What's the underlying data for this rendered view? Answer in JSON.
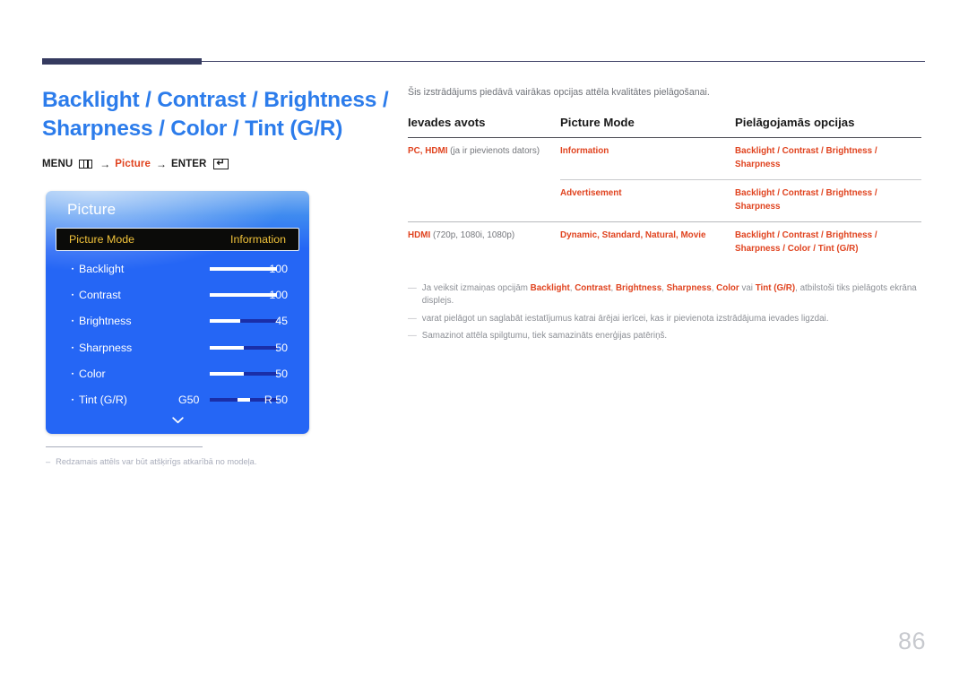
{
  "document": {
    "page_number": "86"
  },
  "left": {
    "title_line1": "Backlight / Contrast / Brightness /",
    "title_line2": "Sharpness / Color / Tint (G/R)",
    "breadcrumb": {
      "menu_label": "MENU",
      "menu_icon": "menu-grid-icon",
      "arrow1": "→",
      "picture_label": "Picture",
      "arrow2": "→",
      "enter_label": "ENTER",
      "enter_icon": "enter-key-icon"
    },
    "footnote": {
      "dash": "–",
      "text": "Redzamais attēls var būt atšķirīgs atkarībā no modeļa."
    }
  },
  "osd": {
    "title": "Picture",
    "selected_row": {
      "label": "Picture Mode",
      "value": "Information"
    },
    "rows": [
      {
        "label": "Backlight",
        "value": "100",
        "left_value": "",
        "fill_pct": 100,
        "centered": false
      },
      {
        "label": "Contrast",
        "value": "100",
        "left_value": "",
        "fill_pct": 100,
        "centered": false
      },
      {
        "label": "Brightness",
        "value": "45",
        "left_value": "",
        "fill_pct": 45,
        "centered": false
      },
      {
        "label": "Sharpness",
        "value": "50",
        "left_value": "",
        "fill_pct": 50,
        "centered": false
      },
      {
        "label": "Color",
        "value": "50",
        "left_value": "",
        "fill_pct": 50,
        "centered": false
      },
      {
        "label": "Tint (G/R)",
        "value": "R 50",
        "left_value": "G50",
        "fill_pct": 0,
        "centered": true
      }
    ],
    "scroll_icon": "chevron-down-icon"
  },
  "right": {
    "intro": "Šis izstrādājums piedāvā vairākas opcijas attēla kvalitātes pielāgošanai.",
    "table": {
      "headers": [
        "Ievades avots",
        "Picture Mode",
        "Pielāgojamās opcijas"
      ],
      "rows": [
        {
          "source_bold": "PC, HDMI",
          "source_plain": " (ja ir pievienots dators)",
          "mode": "Information",
          "adjustable_line1": "Backlight / Contrast / Brightness /",
          "adjustable_line2": "Sharpness",
          "divider": "major"
        },
        {
          "source_bold": "",
          "source_plain": "",
          "mode": "Advertisement",
          "adjustable_line1": "Backlight / Contrast / Brightness /",
          "adjustable_line2": "Sharpness",
          "divider": "sub"
        },
        {
          "source_bold": "HDMI",
          "source_plain": " (720p, 1080i, 1080p)",
          "mode": "Dynamic, Standard, Natural, Movie",
          "adjustable_line1": "Backlight / Contrast / Brightness /",
          "adjustable_line2": "Sharpness / Color / Tint (G/R)",
          "divider": "major"
        }
      ]
    },
    "notes": [
      {
        "dash": "—",
        "pre": "Ja veiksit izmaiņas opcijām ",
        "kw1": "Backlight",
        "mid1": ", ",
        "kw2": "Contrast",
        "mid2": ", ",
        "kw3": "Brightness",
        "mid3": ", ",
        "kw4": "Sharpness",
        "mid4": ", ",
        "kw5": "Color",
        "mid5": " vai ",
        "kw6": "Tint (G/R)",
        "post": ", atbilstoši tiks pielāgots ekrāna displejs."
      },
      {
        "dash": "—",
        "text": "varat pielāgot un saglabāt iestatījumus katrai ārējai ierīcei, kas ir pievienota izstrādājuma ievades ligzdai."
      },
      {
        "dash": "—",
        "text": "Samazinot attēla spilgtumu, tiek samazināts enerģijas patēriņš."
      }
    ]
  },
  "colors": {
    "title_blue": "#2c7ceb",
    "accent_red": "#e0431f",
    "osd_blue": "#2566f5",
    "osd_highlight_text": "#f0c23a",
    "rule_navy": "#353a5f"
  }
}
